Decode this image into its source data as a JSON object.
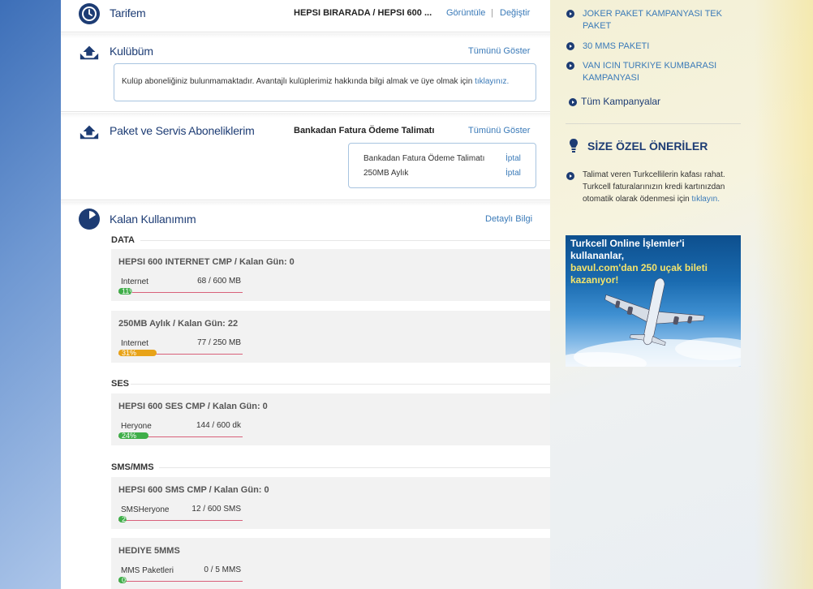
{
  "tariff": {
    "title": "Tarifem",
    "plan": "HEPSI BIRARADA / HEPSI 600 ...",
    "view_link": "Görüntüle",
    "separator": "|",
    "change_link": "Değiştir"
  },
  "club": {
    "title": "Kulübüm",
    "show_all": "Tümünü Göster",
    "message": "Kulüp aboneliğiniz bulunmamaktadır. Avantajlı kulüplerimiz hakkında bilgi almak ve üye olmak için",
    "message_link": "tıklayınız."
  },
  "subscriptions": {
    "title": "Paket ve Servis Aboneliklerim",
    "highlight": "Bankadan Fatura Ödeme Talimatı",
    "show_all": "Tümünü Göster",
    "items": [
      {
        "name": "Bankadan Fatura Ödeme Talimatı",
        "action": "İptal"
      },
      {
        "name": "250MB Aylık",
        "action": "İptal"
      }
    ]
  },
  "usage": {
    "title": "Kalan Kullanımım",
    "detail_link": "Detaylı Bilgi",
    "categories": [
      {
        "label": "DATA",
        "items": [
          {
            "title": "HEPSI 600 INTERNET CMP / Kalan Gün: 0",
            "name": "Internet",
            "value": "68 / 600 MB",
            "percent_label": "11%",
            "percent": 11,
            "color": "#3fae49"
          },
          {
            "title": "250MB Aylık / Kalan Gün: 22",
            "name": "Internet",
            "value": "77 / 250 MB",
            "percent_label": "31%",
            "percent": 31,
            "color": "#e8a318"
          }
        ]
      },
      {
        "label": "SES",
        "items": [
          {
            "title": "HEPSI 600 SES CMP / Kalan Gün: 0",
            "name": "Heryone",
            "value": "144 / 600 dk",
            "percent_label": "24%",
            "percent": 24,
            "color": "#3fae49"
          }
        ]
      },
      {
        "label": "SMS/MMS",
        "items": [
          {
            "title": "HEPSI 600 SMS CMP / Kalan Gün: 0",
            "name": "SMSHeryone",
            "value": "12 / 600 SMS",
            "percent_label": "2%",
            "percent": 2,
            "color": "#3fae49"
          },
          {
            "title": "HEDIYE 5MMS",
            "name": "MMS Paketleri",
            "value": "0 / 5 MMS",
            "percent_label": "0%",
            "percent": 0,
            "color": "#3fae49"
          }
        ]
      }
    ]
  },
  "campaigns": {
    "items": [
      "JOKER PAKET KAMPANYASI TEK PAKET",
      "30 MMS PAKETI",
      "VAN ICIN TURKIYE KUMBARASI KAMPANYASI"
    ],
    "all_link": "Tüm Kampanyalar"
  },
  "suggestions": {
    "title": "SİZE ÖZEL ÖNERİLER",
    "text": "Talimat veren Turkcellilerin kafası rahat. Turkcell faturalarınızın kredi kartınızdan otomatik olarak ödenmesi için",
    "link": "tıklayın."
  },
  "banner": {
    "line1": "Turkcell Online İşlemler'i kullananlar,",
    "line2": "bavul.com'dan 250 uçak bileti kazanıyor!"
  },
  "colors": {
    "brand_navy": "#1d3c74",
    "link_blue": "#3a7ab8",
    "bar_green": "#3fae49",
    "bar_orange": "#e8a318",
    "bar_baseline": "#d8607a"
  }
}
